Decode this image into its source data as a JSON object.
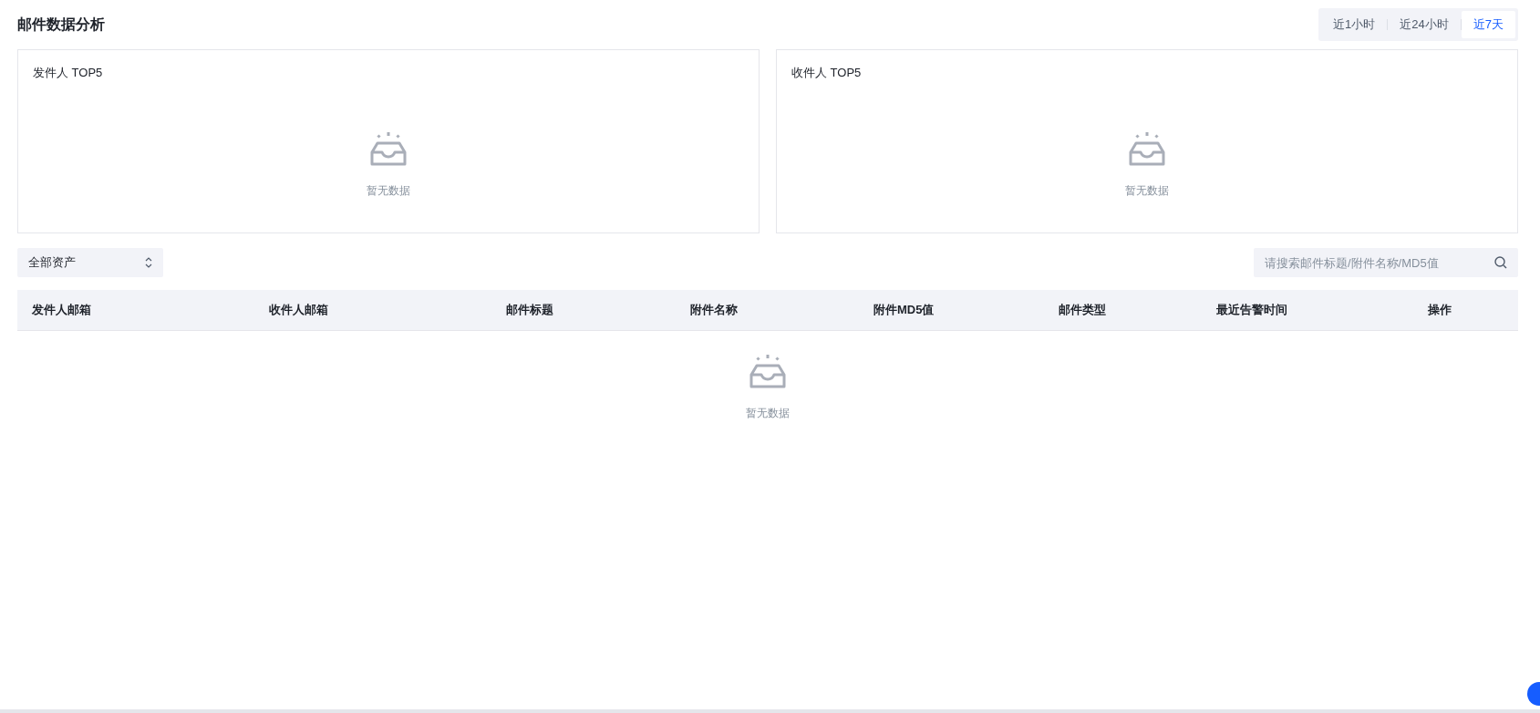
{
  "page_title": "邮件数据分析",
  "time_tabs": [
    {
      "label": "近1小时",
      "selected": false
    },
    {
      "label": "近24小时",
      "selected": false
    },
    {
      "label": "近7天",
      "selected": true
    }
  ],
  "cards": [
    {
      "title": "发件人 TOP5",
      "empty_text": "暂无数据"
    },
    {
      "title": "收件人 TOP5",
      "empty_text": "暂无数据"
    }
  ],
  "asset_select": {
    "value": "全部资产"
  },
  "search": {
    "placeholder": "请搜索邮件标题/附件名称/MD5值"
  },
  "table": {
    "columns": [
      "发件人邮箱",
      "收件人邮箱",
      "邮件标题",
      "附件名称",
      "附件MD5值",
      "邮件类型",
      "最近告警时间",
      "操作"
    ],
    "empty_text": "暂无数据"
  }
}
